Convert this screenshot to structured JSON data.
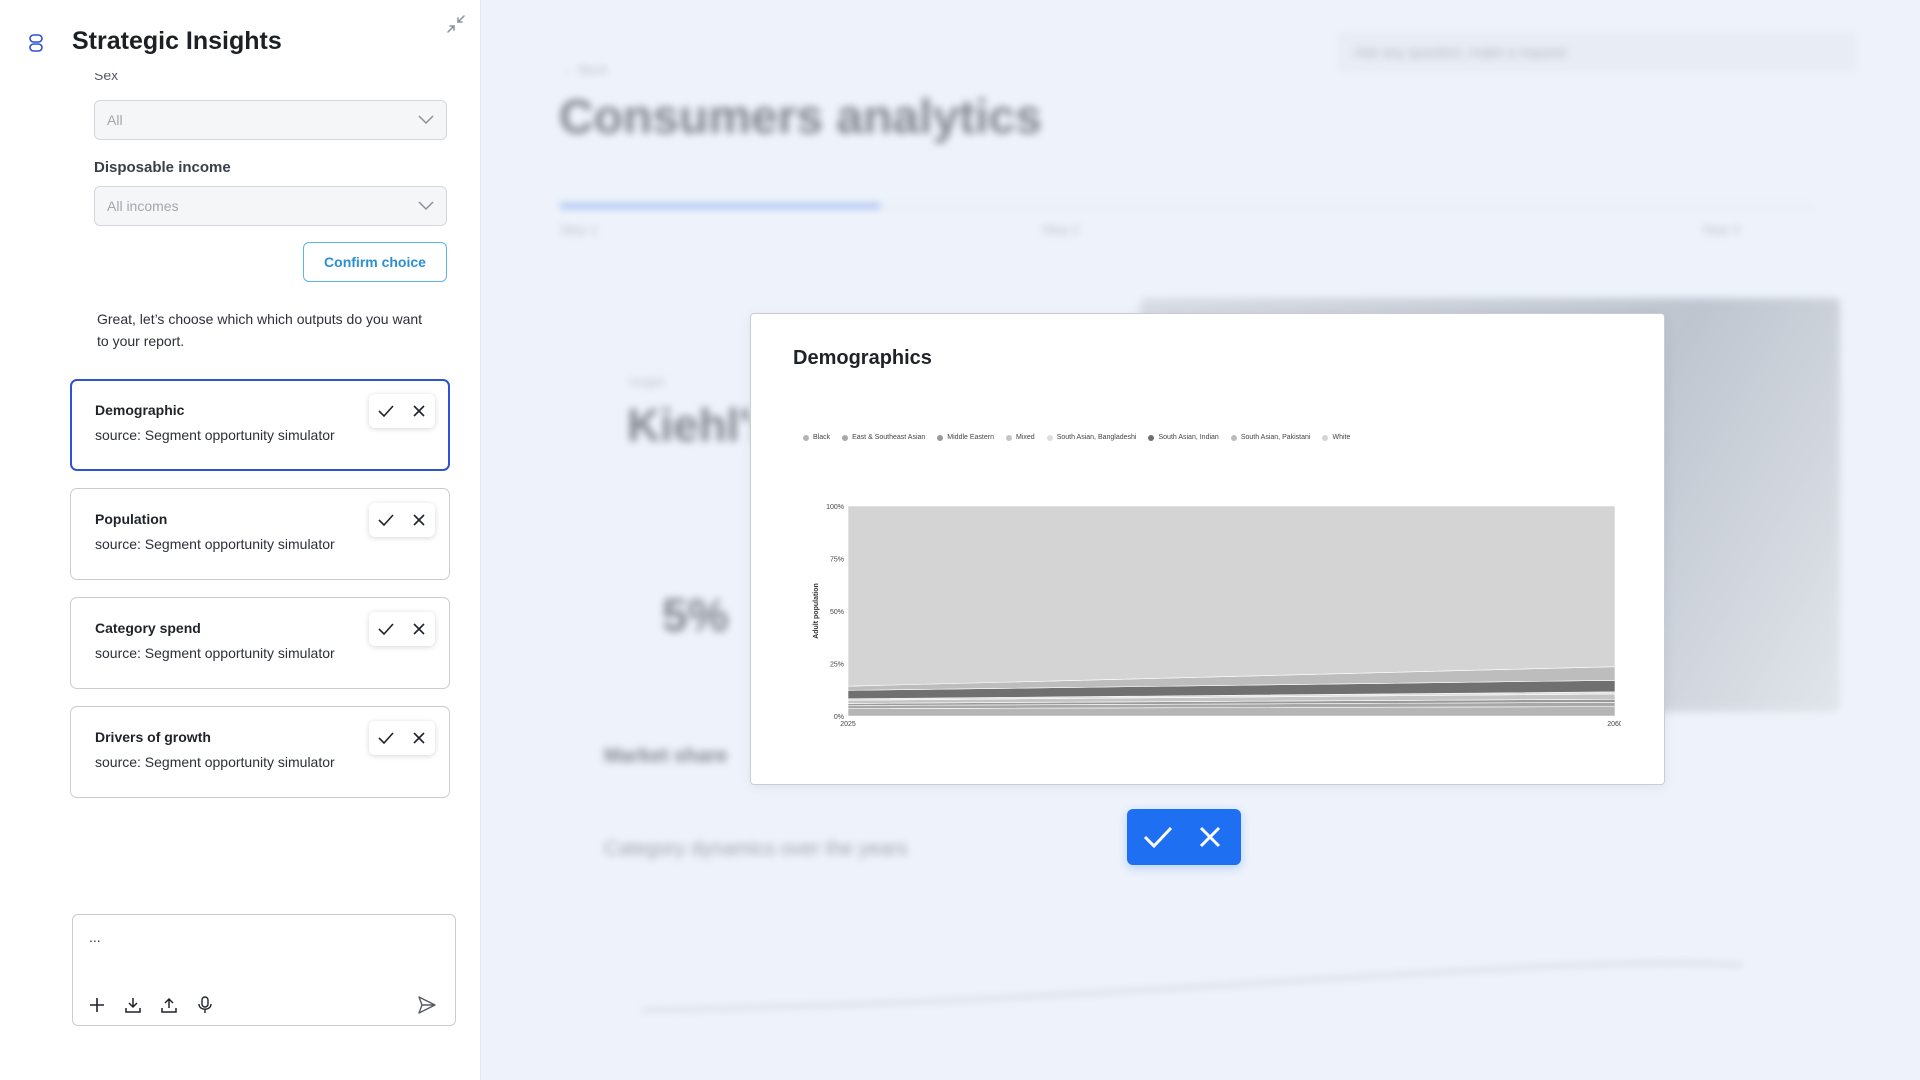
{
  "panel": {
    "title": "Strategic Insights",
    "cut_label": "Sex",
    "fields": [
      {
        "label": "",
        "value": "All"
      },
      {
        "label": "Disposable income",
        "value": "All incomes"
      }
    ],
    "confirm_label": "Confirm choice",
    "assistant_message": "Great, let’s choose which which outputs do you want to your report.",
    "cards": [
      {
        "title": "Demographic",
        "source": "source: Segment opportunity simulator"
      },
      {
        "title": "Population",
        "source": "source: Segment opportunity simulator"
      },
      {
        "title": "Category spend",
        "source": "source: Segment opportunity simulator"
      },
      {
        "title": "Drivers of growth",
        "source": "source: Segment opportunity simulator"
      }
    ],
    "chat": {
      "value": "..."
    }
  },
  "background": {
    "search_placeholder": "Ask any question, make a request",
    "breadcrumb": "← Back",
    "heading": "Consumers analytics",
    "steps": [
      "Step 1",
      "Step 2",
      "Step 3"
    ],
    "kicker": "Insight",
    "subheading": "Kiehl's",
    "paragraph": "",
    "stat": "5%",
    "section": "Market share",
    "sub": "Category dynamics over the years"
  },
  "modal": {
    "title": "Demographics"
  },
  "chart_data": {
    "type": "area",
    "stacked": true,
    "normalized": true,
    "x": [
      2025,
      2060
    ],
    "ylabel": "Adult population",
    "y_ticks": [
      "0%",
      "25%",
      "50%",
      "75%",
      "100%"
    ],
    "x_ticks": [
      "2025",
      "2060"
    ],
    "ylim": [
      0,
      100
    ],
    "legend_position": "top-left",
    "series": [
      {
        "name": "Black",
        "values": [
          3.5,
          4.5
        ],
        "color": "#b5b5b5"
      },
      {
        "name": "East & Southeast Asian",
        "values": [
          1.5,
          2.0
        ],
        "color": "#a8a8a8"
      },
      {
        "name": "Middle Eastern",
        "values": [
          1.0,
          1.5
        ],
        "color": "#9a9a9a"
      },
      {
        "name": "Mixed",
        "values": [
          1.5,
          2.5
        ],
        "color": "#c5c5c5"
      },
      {
        "name": "South Asian, Bangladeshi",
        "values": [
          0.7,
          1.0
        ],
        "color": "#dedede"
      },
      {
        "name": "South Asian, Indian",
        "values": [
          4.0,
          5.5
        ],
        "color": "#707070"
      },
      {
        "name": "South Asian, Pakistani",
        "values": [
          2.0,
          6.5
        ],
        "color": "#bdbdbd"
      },
      {
        "name": "White",
        "values": [
          85.8,
          76.5
        ],
        "color": "#d4d4d4"
      }
    ]
  }
}
